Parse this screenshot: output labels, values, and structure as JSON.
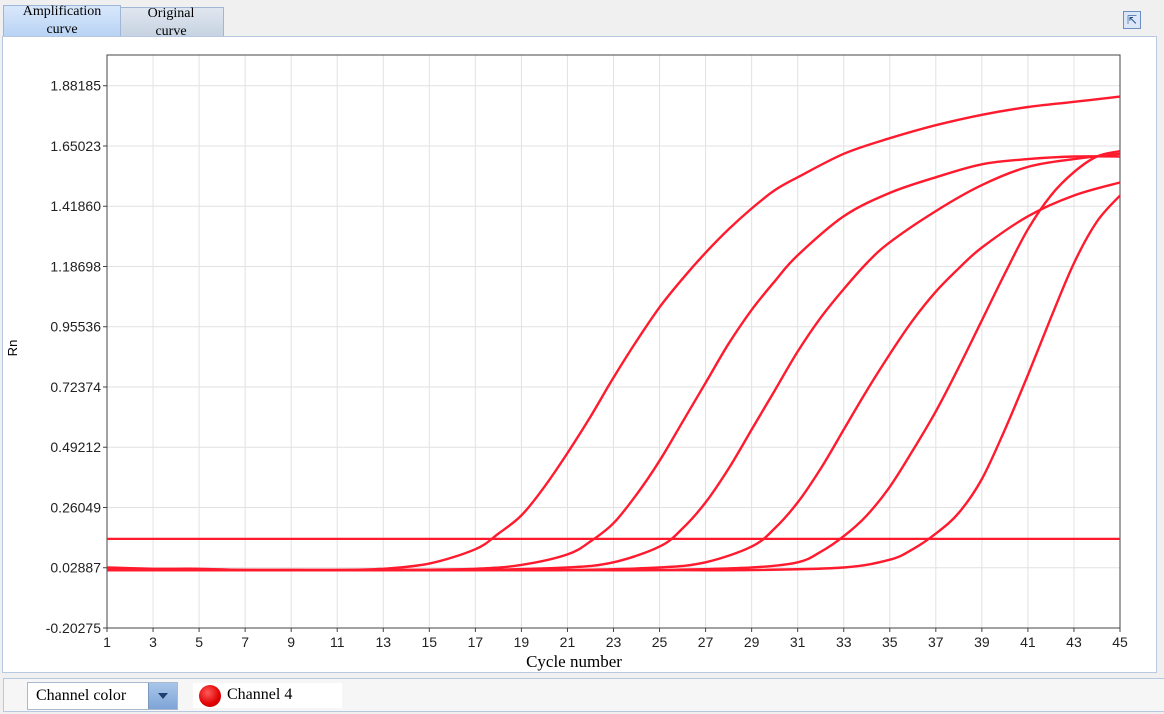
{
  "tabs": [
    {
      "line1": "Amplification",
      "line2": "curve",
      "active": true
    },
    {
      "line1": "Original",
      "line2": "curve",
      "active": false
    }
  ],
  "footer": {
    "combo_label": "Channel color",
    "legend_label": "Channel 4",
    "legend_color": "#ff0000"
  },
  "chart_data": {
    "type": "line",
    "xlabel": "Cycle number",
    "ylabel": "Rn",
    "xlim": [
      1,
      45
    ],
    "ylim": [
      -0.20275,
      2.0
    ],
    "xticks": [
      1,
      3,
      5,
      7,
      9,
      11,
      13,
      15,
      17,
      19,
      21,
      23,
      25,
      27,
      29,
      31,
      33,
      35,
      37,
      39,
      41,
      43,
      45
    ],
    "yticks": [
      -0.20275,
      0.02887,
      0.26049,
      0.49212,
      0.72374,
      0.95536,
      1.18698,
      1.4186,
      1.65023,
      1.88185
    ],
    "ytick_labels": [
      "-0.20275",
      "0.02887",
      "0.26049",
      "0.49212",
      "0.72374",
      "0.95536",
      "1.18698",
      "1.41860",
      "1.65023",
      "1.88185"
    ],
    "grid": true,
    "line_color": "#ff1a2e",
    "threshold": 0.14,
    "series": [
      {
        "x": [
          1,
          3,
          5,
          7,
          9,
          11,
          13,
          15,
          17,
          18,
          19,
          20,
          21,
          22,
          23,
          24,
          25,
          26,
          27,
          28,
          29,
          30,
          31,
          33,
          35,
          37,
          39,
          41,
          43,
          45
        ],
        "y": [
          0.03,
          0.025,
          0.025,
          0.02,
          0.02,
          0.02,
          0.025,
          0.045,
          0.1,
          0.16,
          0.23,
          0.34,
          0.47,
          0.61,
          0.76,
          0.9,
          1.03,
          1.14,
          1.24,
          1.33,
          1.41,
          1.48,
          1.53,
          1.62,
          1.68,
          1.73,
          1.77,
          1.8,
          1.82,
          1.84
        ]
      },
      {
        "x": [
          1,
          5,
          9,
          13,
          17,
          19,
          21,
          22,
          23,
          24,
          25,
          26,
          27,
          28,
          29,
          30,
          31,
          33,
          35,
          37,
          39,
          41,
          43,
          45
        ],
        "y": [
          0.02,
          0.02,
          0.02,
          0.02,
          0.025,
          0.04,
          0.08,
          0.13,
          0.2,
          0.31,
          0.44,
          0.59,
          0.74,
          0.89,
          1.02,
          1.13,
          1.23,
          1.38,
          1.47,
          1.53,
          1.58,
          1.6,
          1.61,
          1.61
        ]
      },
      {
        "x": [
          1,
          5,
          9,
          13,
          17,
          21,
          23,
          25,
          26,
          27,
          28,
          29,
          30,
          31,
          32,
          33,
          34,
          35,
          37,
          39,
          41,
          43,
          45
        ],
        "y": [
          0.02,
          0.02,
          0.02,
          0.02,
          0.02,
          0.03,
          0.05,
          0.11,
          0.18,
          0.28,
          0.41,
          0.56,
          0.71,
          0.86,
          0.99,
          1.1,
          1.2,
          1.28,
          1.4,
          1.5,
          1.57,
          1.6,
          1.62
        ]
      },
      {
        "x": [
          1,
          5,
          9,
          13,
          17,
          21,
          25,
          27,
          29,
          30,
          31,
          32,
          33,
          34,
          35,
          36,
          37,
          38,
          39,
          41,
          43,
          45
        ],
        "y": [
          0.02,
          0.02,
          0.02,
          0.02,
          0.02,
          0.02,
          0.03,
          0.05,
          0.11,
          0.18,
          0.28,
          0.41,
          0.56,
          0.71,
          0.85,
          0.98,
          1.09,
          1.18,
          1.26,
          1.38,
          1.46,
          1.51
        ]
      },
      {
        "x": [
          1,
          5,
          9,
          13,
          17,
          21,
          25,
          29,
          31,
          32,
          33,
          34,
          35,
          36,
          37,
          38,
          39,
          40,
          41,
          42,
          43,
          44,
          45
        ],
        "y": [
          0.02,
          0.02,
          0.02,
          0.02,
          0.02,
          0.02,
          0.02,
          0.03,
          0.05,
          0.09,
          0.15,
          0.23,
          0.34,
          0.48,
          0.63,
          0.8,
          0.98,
          1.16,
          1.33,
          1.46,
          1.55,
          1.61,
          1.63
        ]
      },
      {
        "x": [
          1,
          5,
          9,
          13,
          17,
          21,
          25,
          29,
          33,
          35,
          36,
          37,
          38,
          39,
          40,
          41,
          42,
          43,
          44,
          45
        ],
        "y": [
          0.02,
          0.02,
          0.02,
          0.02,
          0.02,
          0.02,
          0.02,
          0.02,
          0.03,
          0.06,
          0.1,
          0.16,
          0.24,
          0.37,
          0.56,
          0.77,
          0.99,
          1.2,
          1.36,
          1.46
        ]
      }
    ]
  }
}
